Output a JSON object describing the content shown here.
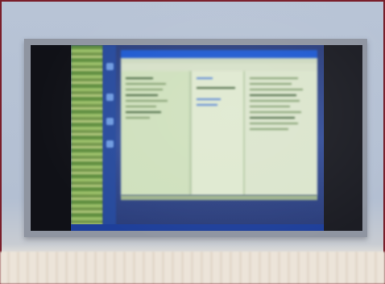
{
  "scene": {
    "subject": "monitor-showing-desktop",
    "colors": {
      "wall": "#b8c4d6",
      "frame": "#8f95a1",
      "screen_black": "#141620",
      "desktop_blue": "#36509a",
      "window_body": "#b9cda9",
      "title_bar": "#1f5ad1",
      "floor": "#efe8de",
      "border": "#7a1e2a"
    }
  },
  "window": {
    "title": ""
  }
}
